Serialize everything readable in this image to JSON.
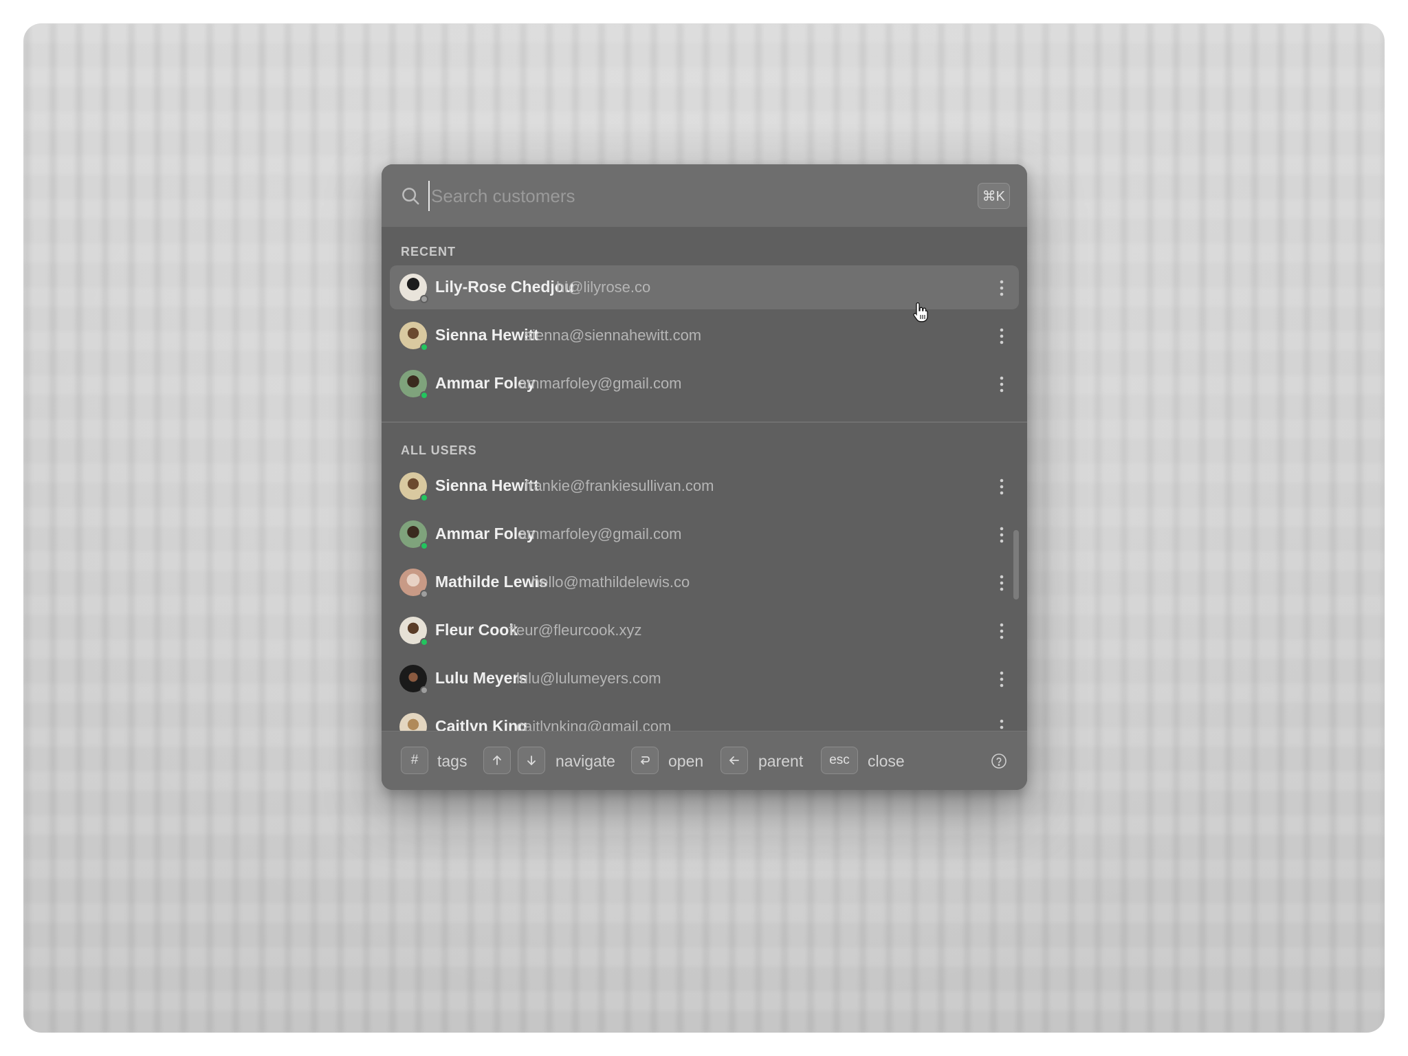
{
  "search": {
    "placeholder": "Search customers",
    "shortcut": "⌘K"
  },
  "sections": {
    "recent_label": "RECENT",
    "all_users_label": "ALL USERS"
  },
  "recent": [
    {
      "name": "Lily-Rose Chedjou",
      "email": "hi@lilyrose.co",
      "status": "offline"
    },
    {
      "name": "Sienna Hewitt",
      "email": "sienna@siennahewitt.com",
      "status": "online"
    },
    {
      "name": "Ammar Foley",
      "email": "ammarfoley@gmail.com",
      "status": "online"
    }
  ],
  "all_users": [
    {
      "name": "Sienna Hewitt",
      "email": "frankie@frankiesullivan.com",
      "status": "online"
    },
    {
      "name": "Ammar Foley",
      "email": "ammarfoley@gmail.com",
      "status": "online"
    },
    {
      "name": "Mathilde Lewis",
      "email": "hello@mathildelewis.co",
      "status": "offline"
    },
    {
      "name": "Fleur Cook",
      "email": "fleur@fleurcook.xyz",
      "status": "online"
    },
    {
      "name": "Lulu Meyers",
      "email": "lulu@lulumeyers.com",
      "status": "offline"
    },
    {
      "name": "Caitlyn King",
      "email": "caitlynking@gmail.com",
      "status": "online"
    }
  ],
  "footer": {
    "tags_key": "#",
    "tags_label": "tags",
    "navigate_label": "navigate",
    "open_label": "open",
    "parent_label": "parent",
    "close_key": "esc",
    "close_label": "close"
  },
  "colors": {
    "online": "#22c55e",
    "offline": "#9e9e9e"
  }
}
